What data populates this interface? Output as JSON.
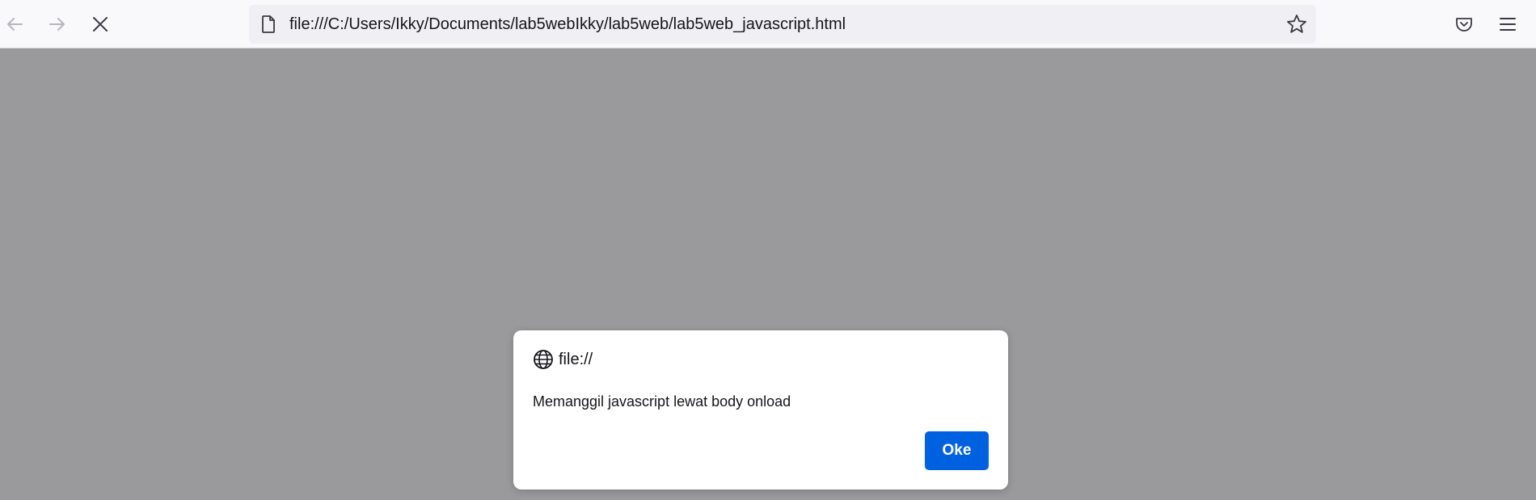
{
  "browser": {
    "url": "file:///C:/Users/Ikky/Documents/lab5webIkky/lab5web/lab5web_javascript.html",
    "nav": {
      "back_icon": "arrow-left-icon",
      "forward_icon": "arrow-right-icon",
      "stop_icon": "close-icon"
    },
    "icons": {
      "page": "page-icon",
      "bookmark": "star-icon",
      "pocket": "pocket-icon",
      "menu": "hamburger-menu-icon"
    }
  },
  "dialog": {
    "origin": "file://",
    "origin_icon": "globe-icon",
    "message": "Memanggil javascript lewat body onload",
    "ok_label": "Oke",
    "ok_color": "#0061e0"
  },
  "colors": {
    "overlay": "#9a9a9c",
    "toolbar": "#f9f9fb",
    "urlbar": "#f0f0f4"
  }
}
